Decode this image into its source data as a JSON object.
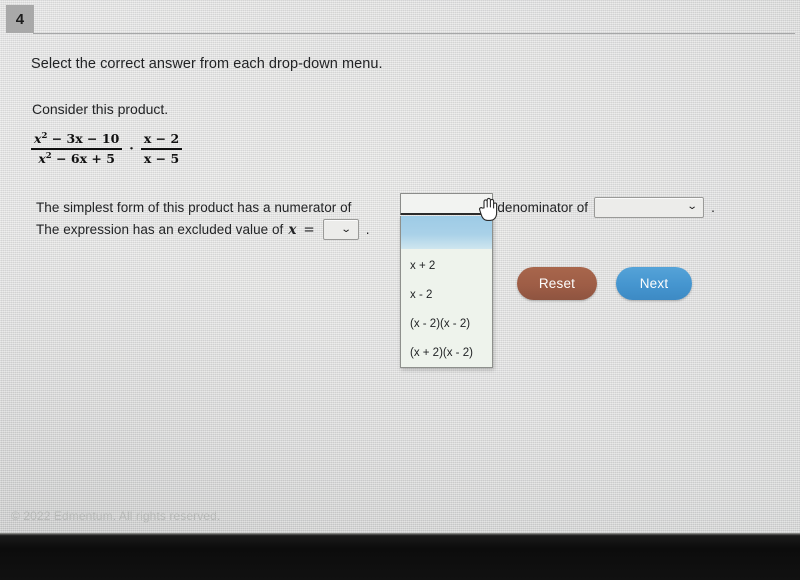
{
  "question": {
    "number": "4",
    "instruction": "Select the correct answer from each drop-down menu.",
    "prompt": "Consider this product."
  },
  "expression": {
    "fraction1": {
      "numerator": "x² − 3x − 10",
      "denominator": "x² − 6x + 5",
      "num_base": "x",
      "num_exp": "2",
      "num_rest": " − 3x − 10",
      "den_base": "x",
      "den_exp": "2",
      "den_rest": " − 6x + 5"
    },
    "operator": "·",
    "fraction2": {
      "numerator": "x − 2",
      "denominator": "x − 5"
    }
  },
  "sentence1": {
    "part_a": "The simplest form of this product has a numerator of",
    "part_b": "and a denominator of",
    "part_c": "."
  },
  "sentence2": {
    "part_a": "The expression has an excluded value of",
    "variable": "x",
    "equals": "=",
    "part_c": "."
  },
  "numerator_select": {
    "name": "numerator-dropdown",
    "value": "",
    "state": "open",
    "caret": "⌄",
    "options": [
      {
        "label": "",
        "highlighted": true
      },
      {
        "label": "x + 2",
        "highlighted": false
      },
      {
        "label": "x - 2",
        "highlighted": false
      },
      {
        "label": "(x - 2)(x - 2)",
        "highlighted": false
      },
      {
        "label": "(x + 2)(x - 2)",
        "highlighted": false
      }
    ]
  },
  "denominator_select": {
    "name": "denominator-dropdown",
    "value": "",
    "state": "closed",
    "caret": "⌄"
  },
  "excluded_select": {
    "name": "excluded-value-dropdown",
    "value": "",
    "state": "closed",
    "caret": "⌄"
  },
  "buttons": {
    "reset": "Reset",
    "next": "Next"
  },
  "footer": {
    "copyright": "© 2022 Edmentum. All rights reserved."
  },
  "colors": {
    "reset_button": "#9e5d46",
    "next_button": "#4595cf",
    "dropdown_highlight": "#9dcbe6",
    "page_background": "#ececeb",
    "tab_background": "#a9a9a9"
  }
}
